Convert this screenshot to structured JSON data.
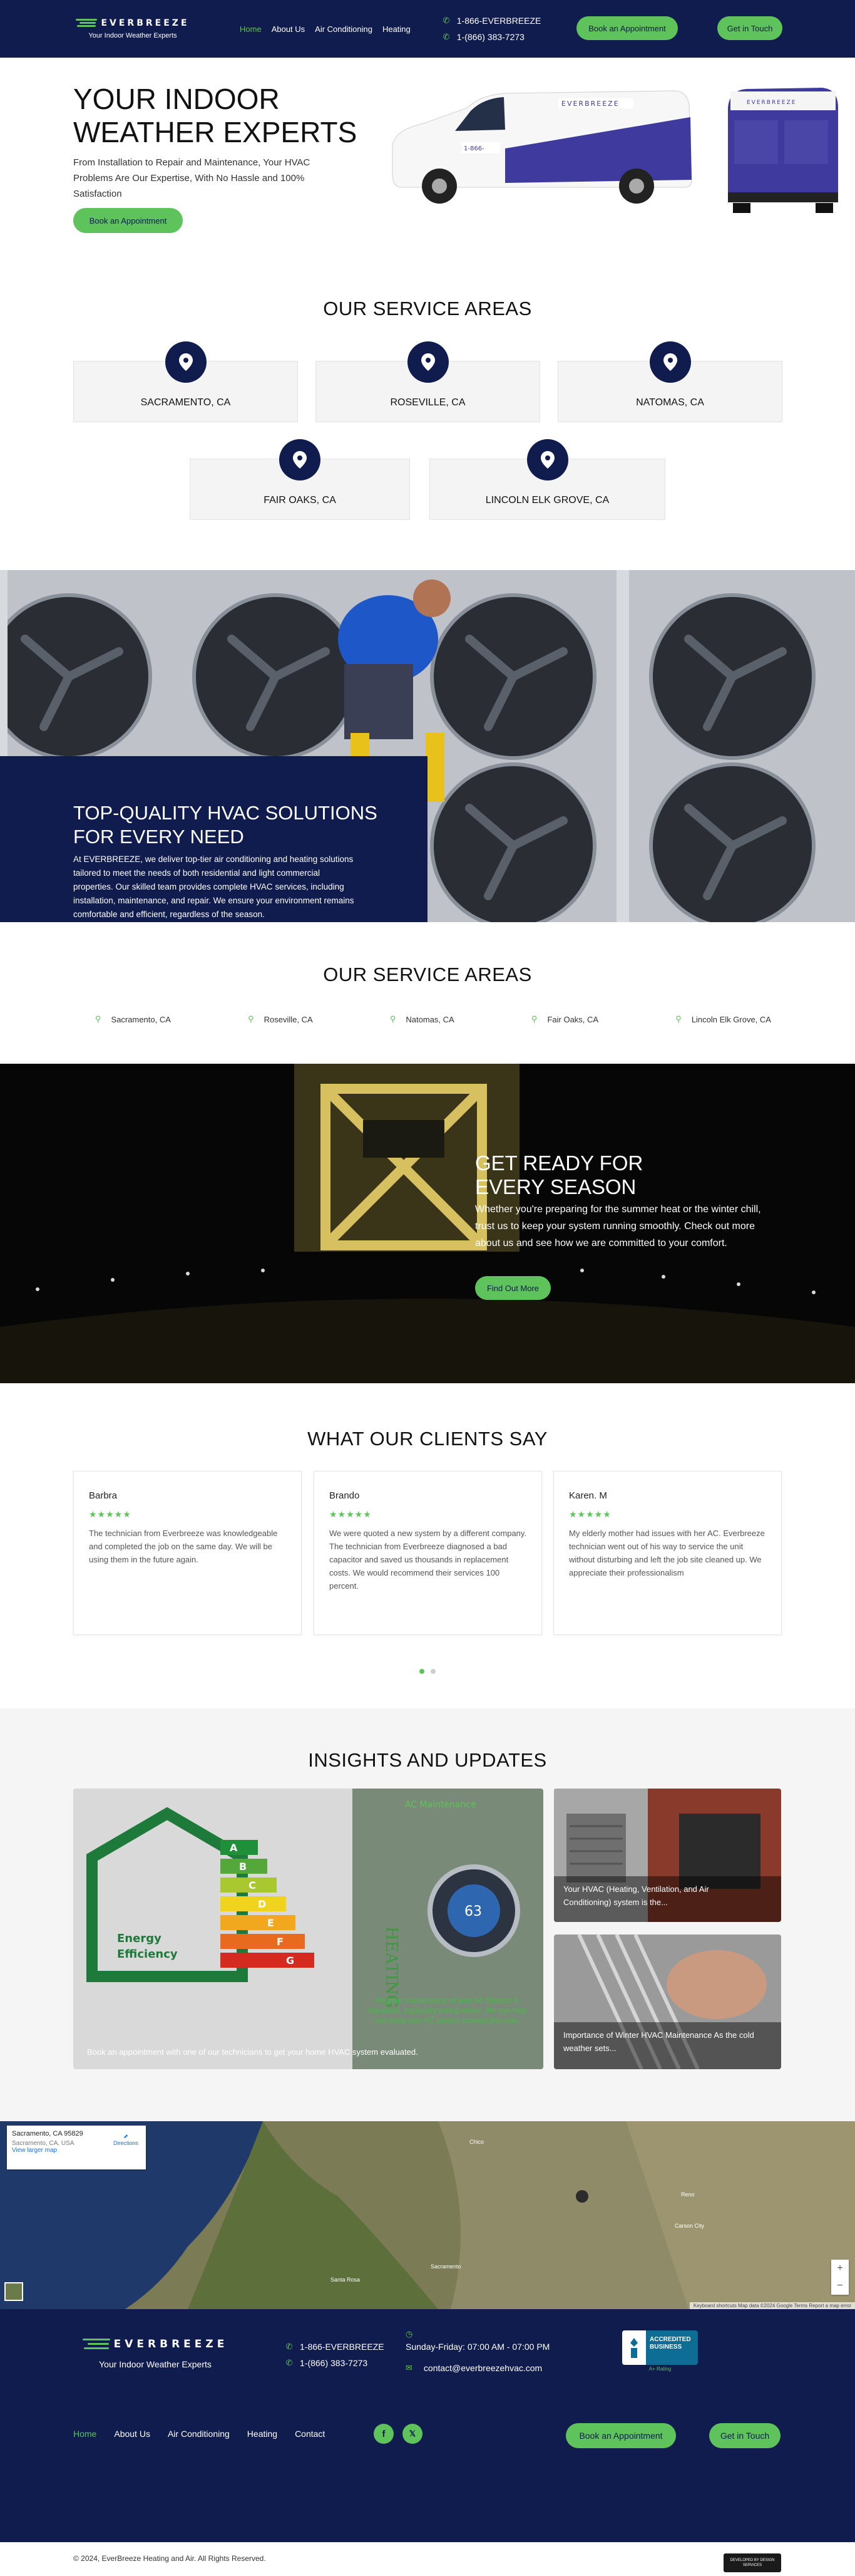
{
  "brand": {
    "name": "EVERBREEZE",
    "tagline": "Your Indoor Weather Experts",
    "green": "#5ec35a",
    "navy": "#101c4e"
  },
  "header": {
    "nav": [
      {
        "label": "Home",
        "active": true
      },
      {
        "label": "About Us",
        "active": false
      },
      {
        "label": "Air Conditioning",
        "active": false
      },
      {
        "label": "Heating",
        "active": false
      }
    ],
    "phones": [
      "1-866-EVERBREEZE",
      "1-(866) 383-7273"
    ],
    "book_label": "Book an Appointment",
    "touch_label": "Get in Touch"
  },
  "hero": {
    "title": "YOUR INDOOR WEATHER EXPERTS",
    "subtitle": "From Installation to Repair and Maintenance, Your HVAC Problems Are Our Expertise, With No Hassle and 100% Satisfaction",
    "cta": "Book an Appointment"
  },
  "service_areas": {
    "title": "OUR SERVICE AREAS",
    "cards": [
      "SACRAMENTO, CA",
      "ROSEVILLE, CA",
      "NATOMAS, CA",
      "FAIR OAKS, CA",
      "LINCOLN ELK GROVE, CA"
    ]
  },
  "hvac_solutions": {
    "title": "TOP-QUALITY HVAC SOLUTIONS FOR EVERY NEED",
    "body": "At EVERBREEZE, we deliver top-tier air conditioning and heating solutions tailored to meet the needs of both residential and light commercial properties. Our skilled team provides complete HVAC services, including installation, maintenance, and repair. We ensure your environment remains comfortable and efficient, regardless of the season."
  },
  "service_areas_list": {
    "title": "OUR SERVICE AREAS",
    "items": [
      "Sacramento, CA",
      "Roseville, CA",
      "Natomas, CA",
      "Fair Oaks, CA",
      "Lincoln Elk Grove, CA"
    ]
  },
  "get_ready": {
    "title": "GET READY FOR EVERY SEASON",
    "body": "Whether you're preparing for the summer heat or the winter chill, trust us to keep your system running smoothly. Check out more about us and see how we are committed to your comfort.",
    "cta": "Find Out More"
  },
  "testimonials": {
    "title": "WHAT OUR CLIENTS SAY",
    "stars": "★★★★★",
    "rating": 5,
    "items": [
      {
        "name": "Barbra",
        "text": "The technician from Everbreeze was knowledgeable and completed the job on the same day. We will be using them in the future again."
      },
      {
        "name": "Brando",
        "text": "We were quoted a new system by a different company. The technician from Everbreeze diagnosed a bad capacitor and saved us thousands in replacement costs. We would recommend their services 100 percent."
      },
      {
        "name": "Karen. M",
        "text": "My elderly mother had issues with her AC. Everbreeze technician went out of his way to service the unit without disturbing and left the job site cleaned up. We appreciate their professionalism"
      }
    ],
    "pages": 2,
    "active_page": 0
  },
  "insights": {
    "title": "INSIGHTS AND UPDATES",
    "posts": [
      {
        "caption": "Book an appointment with one of our technicians to get your home HVAC system evaluated."
      },
      {
        "caption": "Your HVAC (Heating, Ventilation, and Air Conditioning) system is the..."
      },
      {
        "caption": "Importance of Winter HVAC Maintenance As the cold weather sets..."
      }
    ],
    "big_image": {
      "grades": [
        "A",
        "B",
        "C",
        "D",
        "E",
        "F",
        "G"
      ],
      "house_label_1": "Energy",
      "house_label_2": "Efficiency",
      "ac_title": "AC Maintenance",
      "ac_text": "Regular maintenance of your AC System is important, especially during winter. We can help you keep your AC system running fine now.",
      "heating_word": "HEATING",
      "thermostat_value": "63"
    }
  },
  "map": {
    "place": "Sacramento, CA 95829",
    "address": "Sacramento, CA, USA",
    "directions": "Directions",
    "view_larger": "View larger map",
    "labels": [
      "Chico",
      "Santa Rosa",
      "Sacramento",
      "Reno",
      "Carson City"
    ],
    "zoom_in": "+",
    "zoom_out": "−",
    "footer": "Keyboard shortcuts   Map data ©2024 Google   Terms   Report a map error"
  },
  "footer": {
    "phones": [
      "1-866-EVERBREEZE",
      "1-(866) 383-7273"
    ],
    "hours": "Sunday-Friday: 07:00 AM - 07:00 PM",
    "email": "contact@everbreezehvac.com",
    "bbb": {
      "line1": "ACCREDITED",
      "line2": "BUSINESS",
      "rating": "A+ Rating"
    },
    "nav": [
      {
        "label": "Home",
        "active": true
      },
      {
        "label": "About Us",
        "active": false
      },
      {
        "label": "Air Conditioning",
        "active": false
      },
      {
        "label": "Heating",
        "active": false
      },
      {
        "label": "Contact",
        "active": false
      }
    ],
    "social": [
      {
        "icon": "facebook-icon",
        "glyph": "f"
      },
      {
        "icon": "x-twitter-icon",
        "glyph": "𝕏"
      }
    ],
    "book_label": "Book an Appointment",
    "touch_label": "Get in Touch",
    "copyright": "© 2024, EverBreeze Heating and Air. All Rights Reserved.",
    "badge_text": "DEVELOPED BY DESIGN SERVICES"
  }
}
